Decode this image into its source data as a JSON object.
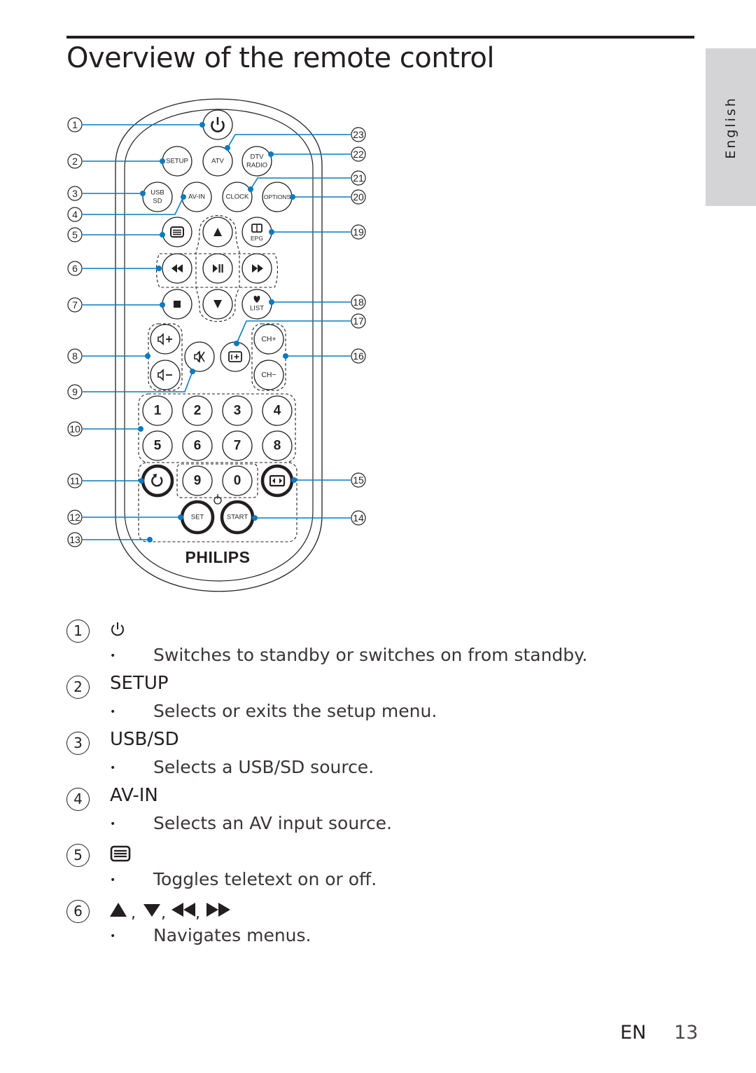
{
  "page": {
    "title": "Overview of the remote control",
    "side_tab": "English",
    "footer_lang": "EN",
    "page_number": "13"
  },
  "accent_color": "#0a7bc1",
  "remote": {
    "brand": "PHILIPS",
    "buttons": {
      "power": "power-icon",
      "setup": "SETUP",
      "atv": "ATV",
      "dtv_radio_1": "DTV",
      "dtv_radio_2": "RADIO",
      "usb_sd_1": "USB",
      "usb_sd_2": "SD",
      "av_in": "AV-IN",
      "clock": "CLOCK",
      "options": "OPTIONS",
      "epg": "EPG",
      "list": "LIST",
      "ch_plus": "CH+",
      "ch_minus": "CH−",
      "set": "SET",
      "start": "START",
      "digits": [
        "1",
        "2",
        "3",
        "4",
        "5",
        "6",
        "7",
        "8",
        "9",
        "0"
      ]
    },
    "callouts_left": [
      "1",
      "2",
      "3",
      "4",
      "5",
      "6",
      "7",
      "8",
      "9",
      "10",
      "11",
      "12",
      "13"
    ],
    "callouts_right": [
      "23",
      "22",
      "21",
      "20",
      "19",
      "18",
      "17",
      "16",
      "15",
      "14"
    ]
  },
  "descriptions": [
    {
      "num": "1",
      "key": "",
      "icon": "power-icon",
      "text": "Switches to standby or switches on from standby."
    },
    {
      "num": "2",
      "key": "SETUP",
      "icon": "",
      "text": "Selects or exits the setup menu."
    },
    {
      "num": "3",
      "key": "USB/SD",
      "icon": "",
      "text": "Selects a USB/SD source."
    },
    {
      "num": "4",
      "key": "AV-IN",
      "icon": "",
      "text": "Selects an AV input source."
    },
    {
      "num": "5",
      "key": "",
      "icon": "teletext-icon",
      "text": "Toggles teletext on or off."
    },
    {
      "num": "6",
      "key": "",
      "icon": "navigation-arrows-icon",
      "text": "Navigates menus."
    }
  ],
  "bullet": "•",
  "nav_separator": ","
}
